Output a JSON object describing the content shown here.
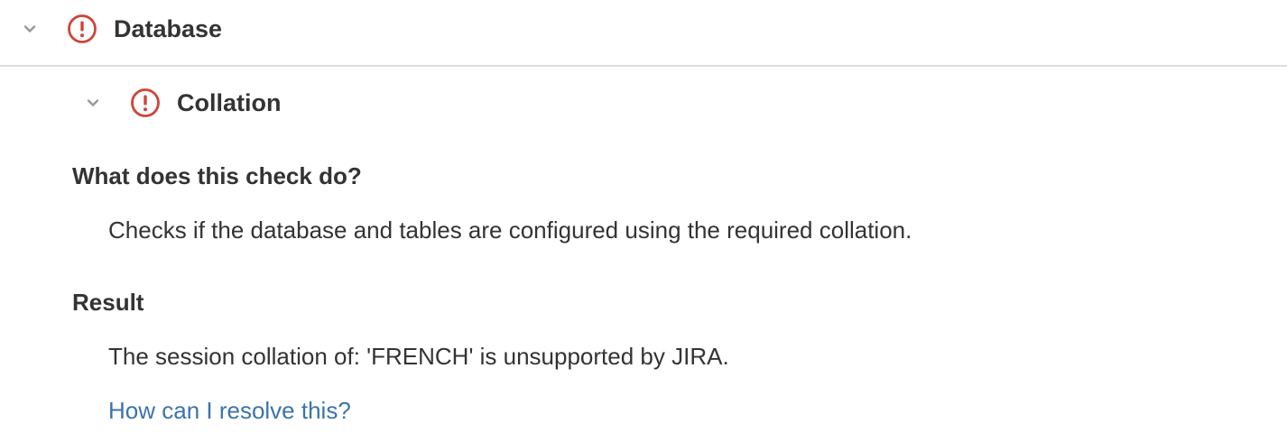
{
  "database_section": {
    "title": "Database",
    "status_icon": "error-icon",
    "expanded": true
  },
  "collation_check": {
    "title": "Collation",
    "status_icon": "error-icon",
    "expanded": true,
    "description_heading": "What does this check do?",
    "description": "Checks if the database and tables are configured using the required collation.",
    "result_heading": "Result",
    "result_text": "The session collation of: 'FRENCH' is unsupported by JIRA.",
    "help_link": "How can I resolve this?"
  },
  "colors": {
    "error": "#d04437",
    "text": "#333333",
    "link": "#3b73af",
    "chevron": "#999999",
    "divider": "#dddddd"
  }
}
